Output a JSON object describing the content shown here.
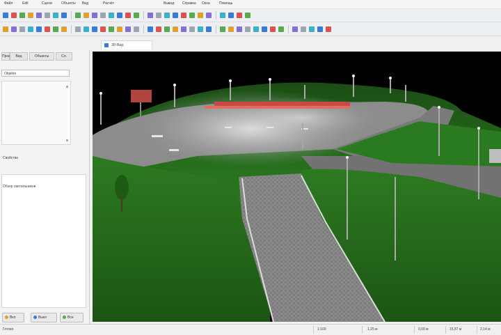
{
  "menu": {
    "items": [
      "Файл",
      "Edit",
      "Сцена",
      "Объекты",
      "Вид",
      "Расчёт",
      "Вывод",
      "Справка",
      "Окна",
      "Помощь"
    ]
  },
  "toolbar": {
    "buttons": [
      "new-icon",
      "open-icon",
      "save-icon",
      "print-icon",
      "undo-icon",
      "redo-icon",
      "select-icon",
      "move-icon",
      "rotate-icon",
      "luminaire-icon",
      "calculation-icon",
      "render-icon"
    ]
  },
  "document_tab": {
    "label": "3D-Вид"
  },
  "left_panel": {
    "tabs": [
      "Проект",
      "Вид",
      "Объекты",
      "Сл."
    ],
    "search_value": "Objekte",
    "caption_1": "Свойства",
    "caption_2": "Обзор светильников",
    "buttons": [
      {
        "label": "Вкл",
        "color": "#e0a030"
      },
      {
        "label": "Выкл",
        "color": "#3a7bd5"
      },
      {
        "label": "Все",
        "color": "#5aa84a"
      }
    ]
  },
  "status_bar": {
    "left_text": "Готово",
    "right_texts": [
      "1:100",
      "1,25 м",
      "0,00 м",
      "15,87 м",
      "2,14 м"
    ]
  },
  "colors": {
    "grass": "#2f8a24",
    "road": "#7d7d7d",
    "building_roof": "#c94a44",
    "sky": "#000000"
  }
}
